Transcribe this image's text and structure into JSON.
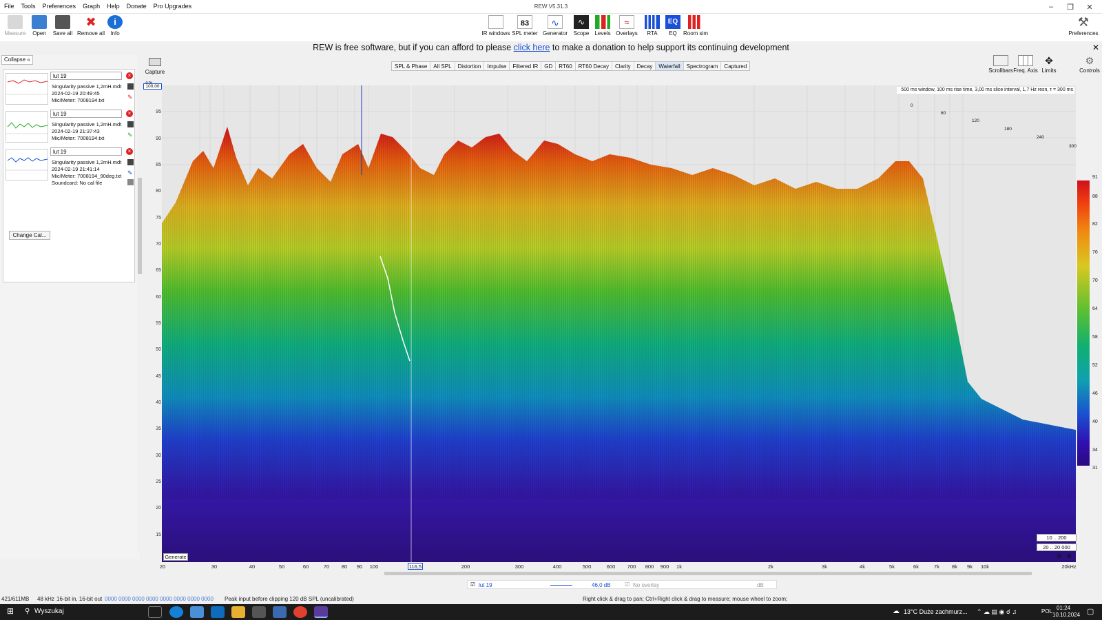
{
  "window": {
    "title": "REW V5.31.3"
  },
  "menu": [
    "File",
    "Tools",
    "Preferences",
    "Graph",
    "Help",
    "Donate",
    "Pro Upgrades"
  ],
  "toolbar_left": [
    "Measure",
    "Open",
    "Save all",
    "Remove all",
    "Info"
  ],
  "toolbar_center": [
    "IR windows",
    "SPL meter",
    "Generator",
    "Scope",
    "Levels",
    "Overlays",
    "RTA",
    "EQ",
    "Room sim"
  ],
  "spl_meter_value": "83",
  "toolbar_right": "Preferences",
  "donation": {
    "before": "REW is free software, but if you can afford to please ",
    "link": "click here",
    "after": " to make a donation to help support its continuing development"
  },
  "panel": {
    "collapse": "Collapse",
    "measurements": [
      {
        "name": "lut 19",
        "file": "Singularity passive 1,2mH.mdt",
        "date": "2024-02-19 20:49:45",
        "mic": "Mic/Meter: 7008194.txt",
        "extra": ""
      },
      {
        "name": "lut 19",
        "file": "Singularity passive 1,2mH.mdt",
        "date": "2024-02-19 21:37:43",
        "mic": "Mic/Meter: 7008194.txt",
        "extra": ""
      },
      {
        "name": "lut 19",
        "file": "Singularity passive 1,2mH.mdt",
        "date": "2024-02-19 21:41:14",
        "mic": "Mic/Meter: 7008194_90deg.txt",
        "extra": "Soundcard: No cal file"
      }
    ],
    "change_cal": "Change Cal..."
  },
  "capture": "Capture",
  "tabs": [
    "SPL & Phase",
    "All SPL",
    "Distortion",
    "Impulse",
    "Filtered IR",
    "GD",
    "RT60",
    "RT60 Decay",
    "Clarity",
    "Decay",
    "Waterfall",
    "Spectrogram",
    "Captured"
  ],
  "active_tab": "Waterfall",
  "right_tools": [
    "Scrollbars",
    "Freq. Axis",
    "Limits",
    "Controls"
  ],
  "graph": {
    "info": "500 ms window, 100 ms rise time, 3,00 ms slice interval, 1,7 Hz resn, τ = 300 ms",
    "ytop": "100,00",
    "spl_label": "SPL",
    "yticks": [
      "95",
      "90",
      "85",
      "80",
      "75",
      "70",
      "65",
      "60",
      "55",
      "50",
      "45",
      "40",
      "35",
      "30",
      "25",
      "20",
      "15"
    ],
    "time_left": [
      "0",
      "120",
      "180",
      "240",
      "300"
    ],
    "time_right": [
      "0",
      "60",
      "120",
      "180",
      "240",
      "300"
    ],
    "xticks": [
      "20",
      "30",
      "40",
      "50",
      "60",
      "70",
      "80",
      "90",
      "100",
      "200",
      "300",
      "400",
      "500",
      "600",
      "700",
      "800",
      "900",
      "1k",
      "2k",
      "3k",
      "4k",
      "5k",
      "6k",
      "7k",
      "8k",
      "9k",
      "10k",
      "20kHz"
    ],
    "cursor": "116,5",
    "colorbar": [
      "91",
      "88",
      "82",
      "76",
      "70",
      "64",
      "58",
      "52",
      "46",
      "40",
      "34",
      "31"
    ],
    "range1": "10 .. 200",
    "range2": "20 .. 20 000",
    "generate": "Generate"
  },
  "legend": {
    "name": "lut 19",
    "value": "46,0 dB",
    "overlay": "No overlay",
    "unit": "dB"
  },
  "status": {
    "mem": "421/611MB",
    "rate": "48 kHz",
    "bits": "16-bit in, 16-bit out",
    "levels": "0000 0000   0000 0000   0000 0000   0000 0000",
    "peak": "Peak input before clipping 120 dB SPL (uncalibrated)",
    "hint": "Right click & drag to pan; Ctrl+Right click & drag to measure; mouse wheel to zoom;"
  },
  "taskbar": {
    "search": "Wyszukaj",
    "weather": "13°C  Duże zachmurz...",
    "lang": "POL",
    "time": "01:24",
    "date": "10.10.2024"
  }
}
